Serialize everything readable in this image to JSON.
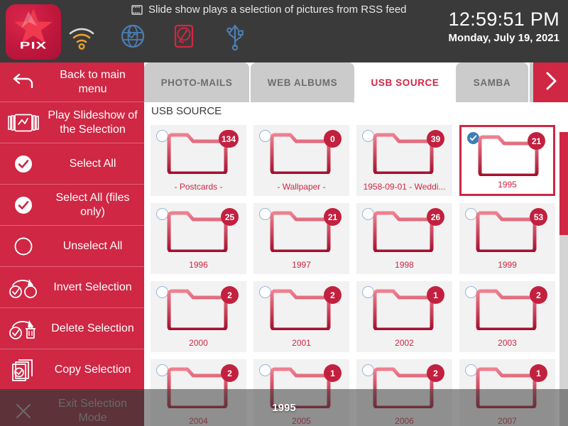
{
  "header": {
    "logo_text": "PIX",
    "title_icon": "film-strip-icon",
    "title": "Slide show plays  a selection of pictures from RSS feed",
    "status_icons": [
      {
        "name": "wifi-icon",
        "color": "#f0a030"
      },
      {
        "name": "globe-icon",
        "color": "#4a7fb5"
      },
      {
        "name": "hard-disk-icon",
        "color": "#d5273f"
      },
      {
        "name": "usb-icon",
        "color": "#4a7fb5"
      }
    ],
    "time": "12:59:51 PM",
    "date": "Monday, July 19, 2021"
  },
  "sidebar": {
    "items": [
      {
        "label": "Back to main menu",
        "icon": "back-arrow-icon"
      },
      {
        "label": "Play Slideshow of the Selection",
        "icon": "filmstrip-play-icon"
      },
      {
        "label": "Select All",
        "icon": "check-circle-filled-icon"
      },
      {
        "label": "Select All (files only)",
        "icon": "check-circle-filled-icon"
      },
      {
        "label": "Unselect All",
        "icon": "empty-circle-icon"
      },
      {
        "label": "Invert Selection",
        "icon": "invert-selection-icon"
      },
      {
        "label": "Delete Selection",
        "icon": "trash-selection-icon"
      },
      {
        "label": "Copy Selection",
        "icon": "copy-selection-icon"
      },
      {
        "label": "Exit Selection Mode",
        "icon": "close-x-icon"
      }
    ]
  },
  "main": {
    "tabs": [
      {
        "label": "PHOTO-MAILS",
        "active": false
      },
      {
        "label": "WEB ALBUMS",
        "active": false
      },
      {
        "label": "USB SOURCE",
        "active": true
      },
      {
        "label": "SAMBA",
        "active": false
      }
    ],
    "next_tab_icon": "chevron-right-icon",
    "breadcrumb": "USB SOURCE",
    "rows": [
      [
        {
          "name": "- Postcards -",
          "count": "134",
          "selected": false
        },
        {
          "name": "- Wallpaper -",
          "count": "0",
          "selected": false
        },
        {
          "name": "1958-09-01 - Weddi...",
          "count": "39",
          "selected": false
        },
        {
          "name": "1995",
          "count": "21",
          "selected": true
        }
      ],
      [
        {
          "name": "1996",
          "count": "25",
          "selected": false
        },
        {
          "name": "1997",
          "count": "21",
          "selected": false
        },
        {
          "name": "1998",
          "count": "26",
          "selected": false
        },
        {
          "name": "1999",
          "count": "53",
          "selected": false
        }
      ],
      [
        {
          "name": "2000",
          "count": "2",
          "selected": false
        },
        {
          "name": "2001",
          "count": "2",
          "selected": false
        },
        {
          "name": "2002",
          "count": "1",
          "selected": false
        },
        {
          "name": "2003",
          "count": "2",
          "selected": false
        }
      ],
      [
        {
          "name": "2004",
          "count": "2",
          "selected": false
        },
        {
          "name": "2005",
          "count": "1",
          "selected": false
        },
        {
          "name": "2006",
          "count": "2",
          "selected": false
        },
        {
          "name": "2007",
          "count": "1",
          "selected": false
        }
      ]
    ]
  },
  "statusbar": {
    "label": "1995"
  },
  "colors": {
    "brand_red": "#cf2744",
    "badge_red": "#c2203f",
    "topbar_gray": "#3a3a3a",
    "tab_inactive": "#cbcbcb",
    "checkbox_blue": "#3d7fb7"
  }
}
